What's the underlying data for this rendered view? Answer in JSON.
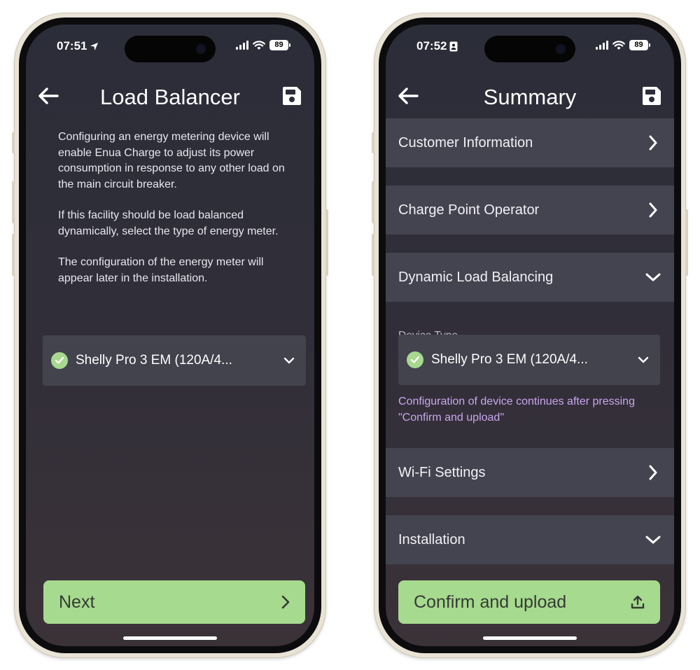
{
  "left_phone": {
    "status": {
      "time": "07:51",
      "battery": "89"
    },
    "header": {
      "title": "Load Balancer"
    },
    "description": [
      "Configuring an energy metering device will enable Enua Charge to adjust its power consumption in response to any other load on the main circuit breaker.",
      "If this facility should be load balanced dynamically, select the type of energy meter.",
      "The configuration of the energy meter will appear later in the installation."
    ],
    "device_select": {
      "value": "Shelly Pro 3 EM (120A/4..."
    },
    "next_button": {
      "label": "Next"
    }
  },
  "right_phone": {
    "status": {
      "time": "07:52",
      "battery": "89"
    },
    "header": {
      "title": "Summary"
    },
    "sections": [
      {
        "title": "Customer Information",
        "state": "collapsed"
      },
      {
        "title": "Charge Point Operator",
        "state": "collapsed"
      },
      {
        "title": "Dynamic Load Balancing",
        "state": "expanded"
      },
      {
        "title": "Wi-Fi Settings",
        "state": "collapsed"
      },
      {
        "title": "Installation",
        "state": "expanded"
      }
    ],
    "dlb": {
      "device_type_label": "Device Type",
      "device_select": {
        "value": "Shelly Pro 3 EM (120A/4..."
      },
      "hint": "Configuration of device continues after pressing \"Confirm and upload\""
    },
    "confirm_button": {
      "label": "Confirm and upload"
    }
  },
  "colors": {
    "accent_green": "#a6da8f",
    "hint_purple": "#c8a6f0",
    "section_bg": "#434450",
    "screen_bg": "#2b2d38"
  }
}
